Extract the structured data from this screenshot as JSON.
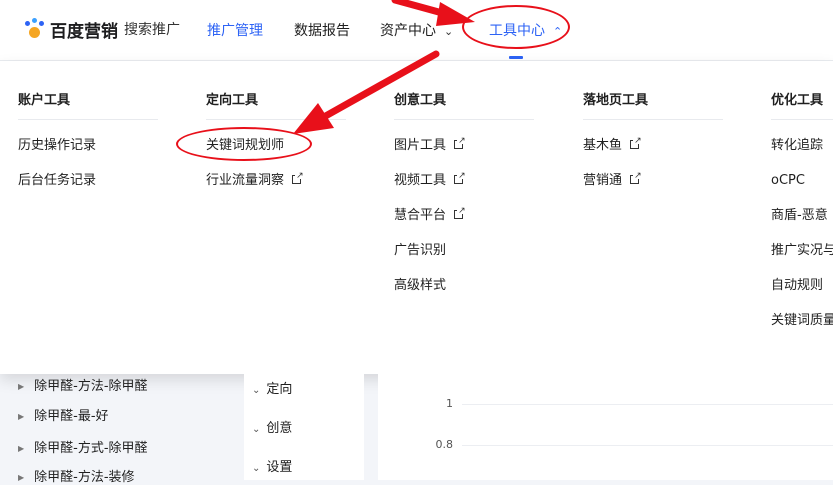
{
  "brand": {
    "name": "百度营销",
    "product": "搜索推广"
  },
  "nav": [
    {
      "label": "推广管理",
      "active": true
    },
    {
      "label": "数据报告"
    },
    {
      "label": "资产中心",
      "has_dropdown": true
    },
    {
      "label": "工具中心",
      "has_dropdown": true,
      "expanded": true
    }
  ],
  "menu": {
    "columns": [
      {
        "title": "账户工具",
        "items": [
          "历史操作记录",
          "后台任务记录"
        ]
      },
      {
        "title": "定向工具",
        "items": [
          "关键词规划师",
          "行业流量洞察"
        ],
        "external": [
          false,
          true
        ]
      },
      {
        "title": "创意工具",
        "items": [
          "图片工具",
          "视频工具",
          "慧合平台",
          "广告识别",
          "高级样式"
        ],
        "external": [
          true,
          true,
          true,
          false,
          false
        ]
      },
      {
        "title": "落地页工具",
        "items": [
          "基木鱼",
          "营销通"
        ],
        "external": [
          true,
          true
        ]
      },
      {
        "title": "优化工具",
        "items": [
          "转化追踪",
          "oCPC",
          "商盾-恶意",
          "推广实况与",
          "自动规则",
          "关键词质量"
        ]
      }
    ]
  },
  "tree": [
    "除甲醛-方法-除甲醛",
    "除甲醛-最-好",
    "除甲醛-方式-除甲醛",
    "除甲醛-方法-装修"
  ],
  "filters": [
    "定向",
    "创意",
    "设置"
  ],
  "chart": {
    "ticks": [
      "1",
      "0.8"
    ]
  },
  "colors": {
    "accent": "#2d63f5",
    "annotation_red": "#e8101a"
  }
}
